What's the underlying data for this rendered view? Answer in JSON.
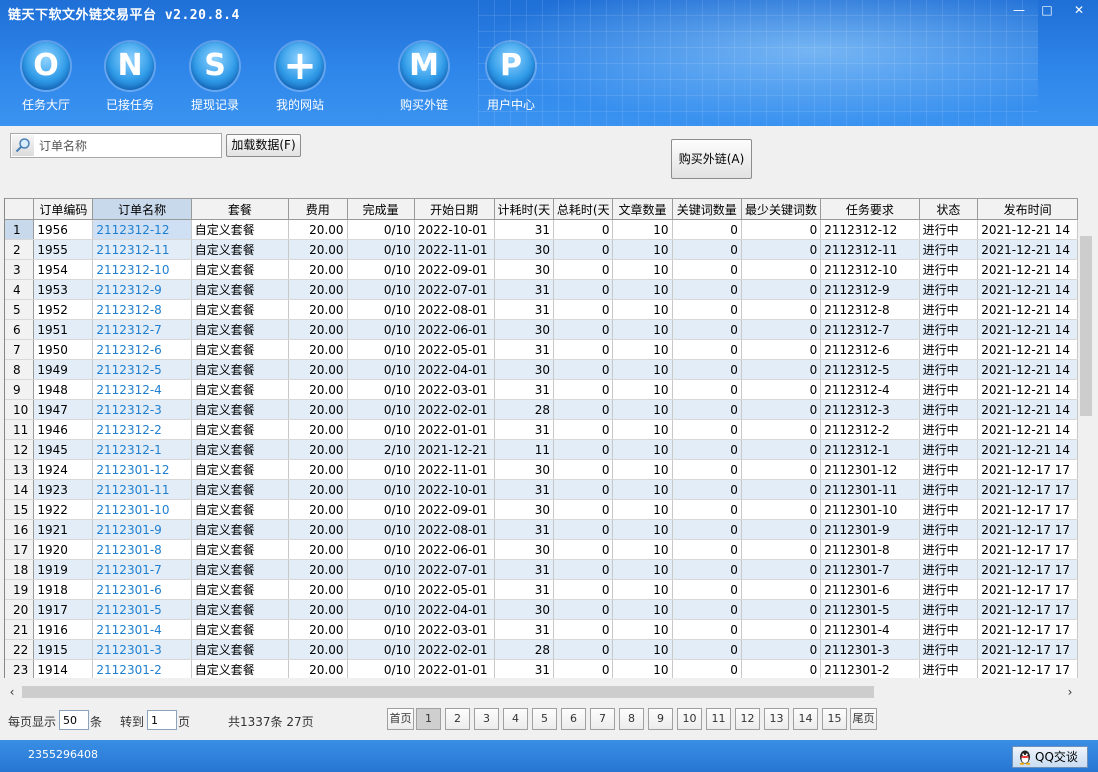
{
  "app": {
    "title": "链天下软文外链交易平台 v2.20.8.4"
  },
  "window": {
    "minimize": "—",
    "maximize": "□",
    "close": "✕"
  },
  "nav": [
    {
      "glyph": "O",
      "label": "任务大厅",
      "icon": "circle-o-icon"
    },
    {
      "glyph": "N",
      "label": "已接任务",
      "icon": "circle-n-icon"
    },
    {
      "glyph": "S",
      "label": "提现记录",
      "icon": "circle-s-icon"
    },
    {
      "glyph": "+",
      "label": "我的网站",
      "icon": "circle-plus-icon"
    },
    {
      "glyph": "M",
      "label": "购买外链",
      "icon": "circle-m-icon"
    },
    {
      "glyph": "P",
      "label": "用户中心",
      "icon": "circle-p-icon"
    }
  ],
  "toolbar": {
    "search_placeholder": "订单名称",
    "load_label": "加载数据(F)",
    "buy_label": "购买外链(A)"
  },
  "table": {
    "columns": [
      "订单编码",
      "订单名称",
      "套餐",
      "费用",
      "完成量",
      "开始日期",
      "计耗时(天",
      "总耗时(天",
      "文章数量",
      "关键词数量",
      "最少关键词数",
      "任务要求",
      "状态",
      "发布时间"
    ],
    "rows": [
      [
        "1",
        "1956",
        "2112312-12",
        "自定义套餐",
        "20.00",
        "0/10",
        "2022-10-01",
        "31",
        "0",
        "10",
        "0",
        "0",
        "2112312-12",
        "进行中",
        "2021-12-21 14"
      ],
      [
        "2",
        "1955",
        "2112312-11",
        "自定义套餐",
        "20.00",
        "0/10",
        "2022-11-01",
        "30",
        "0",
        "10",
        "0",
        "0",
        "2112312-11",
        "进行中",
        "2021-12-21 14"
      ],
      [
        "3",
        "1954",
        "2112312-10",
        "自定义套餐",
        "20.00",
        "0/10",
        "2022-09-01",
        "30",
        "0",
        "10",
        "0",
        "0",
        "2112312-10",
        "进行中",
        "2021-12-21 14"
      ],
      [
        "4",
        "1953",
        "2112312-9",
        "自定义套餐",
        "20.00",
        "0/10",
        "2022-07-01",
        "31",
        "0",
        "10",
        "0",
        "0",
        "2112312-9",
        "进行中",
        "2021-12-21 14"
      ],
      [
        "5",
        "1952",
        "2112312-8",
        "自定义套餐",
        "20.00",
        "0/10",
        "2022-08-01",
        "31",
        "0",
        "10",
        "0",
        "0",
        "2112312-8",
        "进行中",
        "2021-12-21 14"
      ],
      [
        "6",
        "1951",
        "2112312-7",
        "自定义套餐",
        "20.00",
        "0/10",
        "2022-06-01",
        "30",
        "0",
        "10",
        "0",
        "0",
        "2112312-7",
        "进行中",
        "2021-12-21 14"
      ],
      [
        "7",
        "1950",
        "2112312-6",
        "自定义套餐",
        "20.00",
        "0/10",
        "2022-05-01",
        "31",
        "0",
        "10",
        "0",
        "0",
        "2112312-6",
        "进行中",
        "2021-12-21 14"
      ],
      [
        "8",
        "1949",
        "2112312-5",
        "自定义套餐",
        "20.00",
        "0/10",
        "2022-04-01",
        "30",
        "0",
        "10",
        "0",
        "0",
        "2112312-5",
        "进行中",
        "2021-12-21 14"
      ],
      [
        "9",
        "1948",
        "2112312-4",
        "自定义套餐",
        "20.00",
        "0/10",
        "2022-03-01",
        "31",
        "0",
        "10",
        "0",
        "0",
        "2112312-4",
        "进行中",
        "2021-12-21 14"
      ],
      [
        "10",
        "1947",
        "2112312-3",
        "自定义套餐",
        "20.00",
        "0/10",
        "2022-02-01",
        "28",
        "0",
        "10",
        "0",
        "0",
        "2112312-3",
        "进行中",
        "2021-12-21 14"
      ],
      [
        "11",
        "1946",
        "2112312-2",
        "自定义套餐",
        "20.00",
        "0/10",
        "2022-01-01",
        "31",
        "0",
        "10",
        "0",
        "0",
        "2112312-2",
        "进行中",
        "2021-12-21 14"
      ],
      [
        "12",
        "1945",
        "2112312-1",
        "自定义套餐",
        "20.00",
        "2/10",
        "2021-12-21",
        "11",
        "0",
        "10",
        "0",
        "0",
        "2112312-1",
        "进行中",
        "2021-12-21 14"
      ],
      [
        "13",
        "1924",
        "2112301-12",
        "自定义套餐",
        "20.00",
        "0/10",
        "2022-11-01",
        "30",
        "0",
        "10",
        "0",
        "0",
        "2112301-12",
        "进行中",
        "2021-12-17 17"
      ],
      [
        "14",
        "1923",
        "2112301-11",
        "自定义套餐",
        "20.00",
        "0/10",
        "2022-10-01",
        "31",
        "0",
        "10",
        "0",
        "0",
        "2112301-11",
        "进行中",
        "2021-12-17 17"
      ],
      [
        "15",
        "1922",
        "2112301-10",
        "自定义套餐",
        "20.00",
        "0/10",
        "2022-09-01",
        "30",
        "0",
        "10",
        "0",
        "0",
        "2112301-10",
        "进行中",
        "2021-12-17 17"
      ],
      [
        "16",
        "1921",
        "2112301-9",
        "自定义套餐",
        "20.00",
        "0/10",
        "2022-08-01",
        "31",
        "0",
        "10",
        "0",
        "0",
        "2112301-9",
        "进行中",
        "2021-12-17 17"
      ],
      [
        "17",
        "1920",
        "2112301-8",
        "自定义套餐",
        "20.00",
        "0/10",
        "2022-06-01",
        "30",
        "0",
        "10",
        "0",
        "0",
        "2112301-8",
        "进行中",
        "2021-12-17 17"
      ],
      [
        "18",
        "1919",
        "2112301-7",
        "自定义套餐",
        "20.00",
        "0/10",
        "2022-07-01",
        "31",
        "0",
        "10",
        "0",
        "0",
        "2112301-7",
        "进行中",
        "2021-12-17 17"
      ],
      [
        "19",
        "1918",
        "2112301-6",
        "自定义套餐",
        "20.00",
        "0/10",
        "2022-05-01",
        "31",
        "0",
        "10",
        "0",
        "0",
        "2112301-6",
        "进行中",
        "2021-12-17 17"
      ],
      [
        "20",
        "1917",
        "2112301-5",
        "自定义套餐",
        "20.00",
        "0/10",
        "2022-04-01",
        "30",
        "0",
        "10",
        "0",
        "0",
        "2112301-5",
        "进行中",
        "2021-12-17 17"
      ],
      [
        "21",
        "1916",
        "2112301-4",
        "自定义套餐",
        "20.00",
        "0/10",
        "2022-03-01",
        "31",
        "0",
        "10",
        "0",
        "0",
        "2112301-4",
        "进行中",
        "2021-12-17 17"
      ],
      [
        "22",
        "1915",
        "2112301-3",
        "自定义套餐",
        "20.00",
        "0/10",
        "2022-02-01",
        "28",
        "0",
        "10",
        "0",
        "0",
        "2112301-3",
        "进行中",
        "2021-12-17 17"
      ],
      [
        "23",
        "1914",
        "2112301-2",
        "自定义套餐",
        "20.00",
        "0/10",
        "2022-01-01",
        "31",
        "0",
        "10",
        "0",
        "0",
        "2112301-2",
        "进行中",
        "2021-12-17 17"
      ]
    ]
  },
  "pager": {
    "per_page_label": "每页显示",
    "per_page_value": "50",
    "unit": "条",
    "goto_label": "转到",
    "goto_value": "1",
    "page_unit": "页",
    "total": "共1337条 27页",
    "first": "首页",
    "last": "尾页",
    "pages": [
      "1",
      "2",
      "3",
      "4",
      "5",
      "6",
      "7",
      "8",
      "9",
      "10",
      "11",
      "12",
      "13",
      "14",
      "15"
    ]
  },
  "status": {
    "text": "2355296408",
    "qq_label": "QQ交谈"
  }
}
